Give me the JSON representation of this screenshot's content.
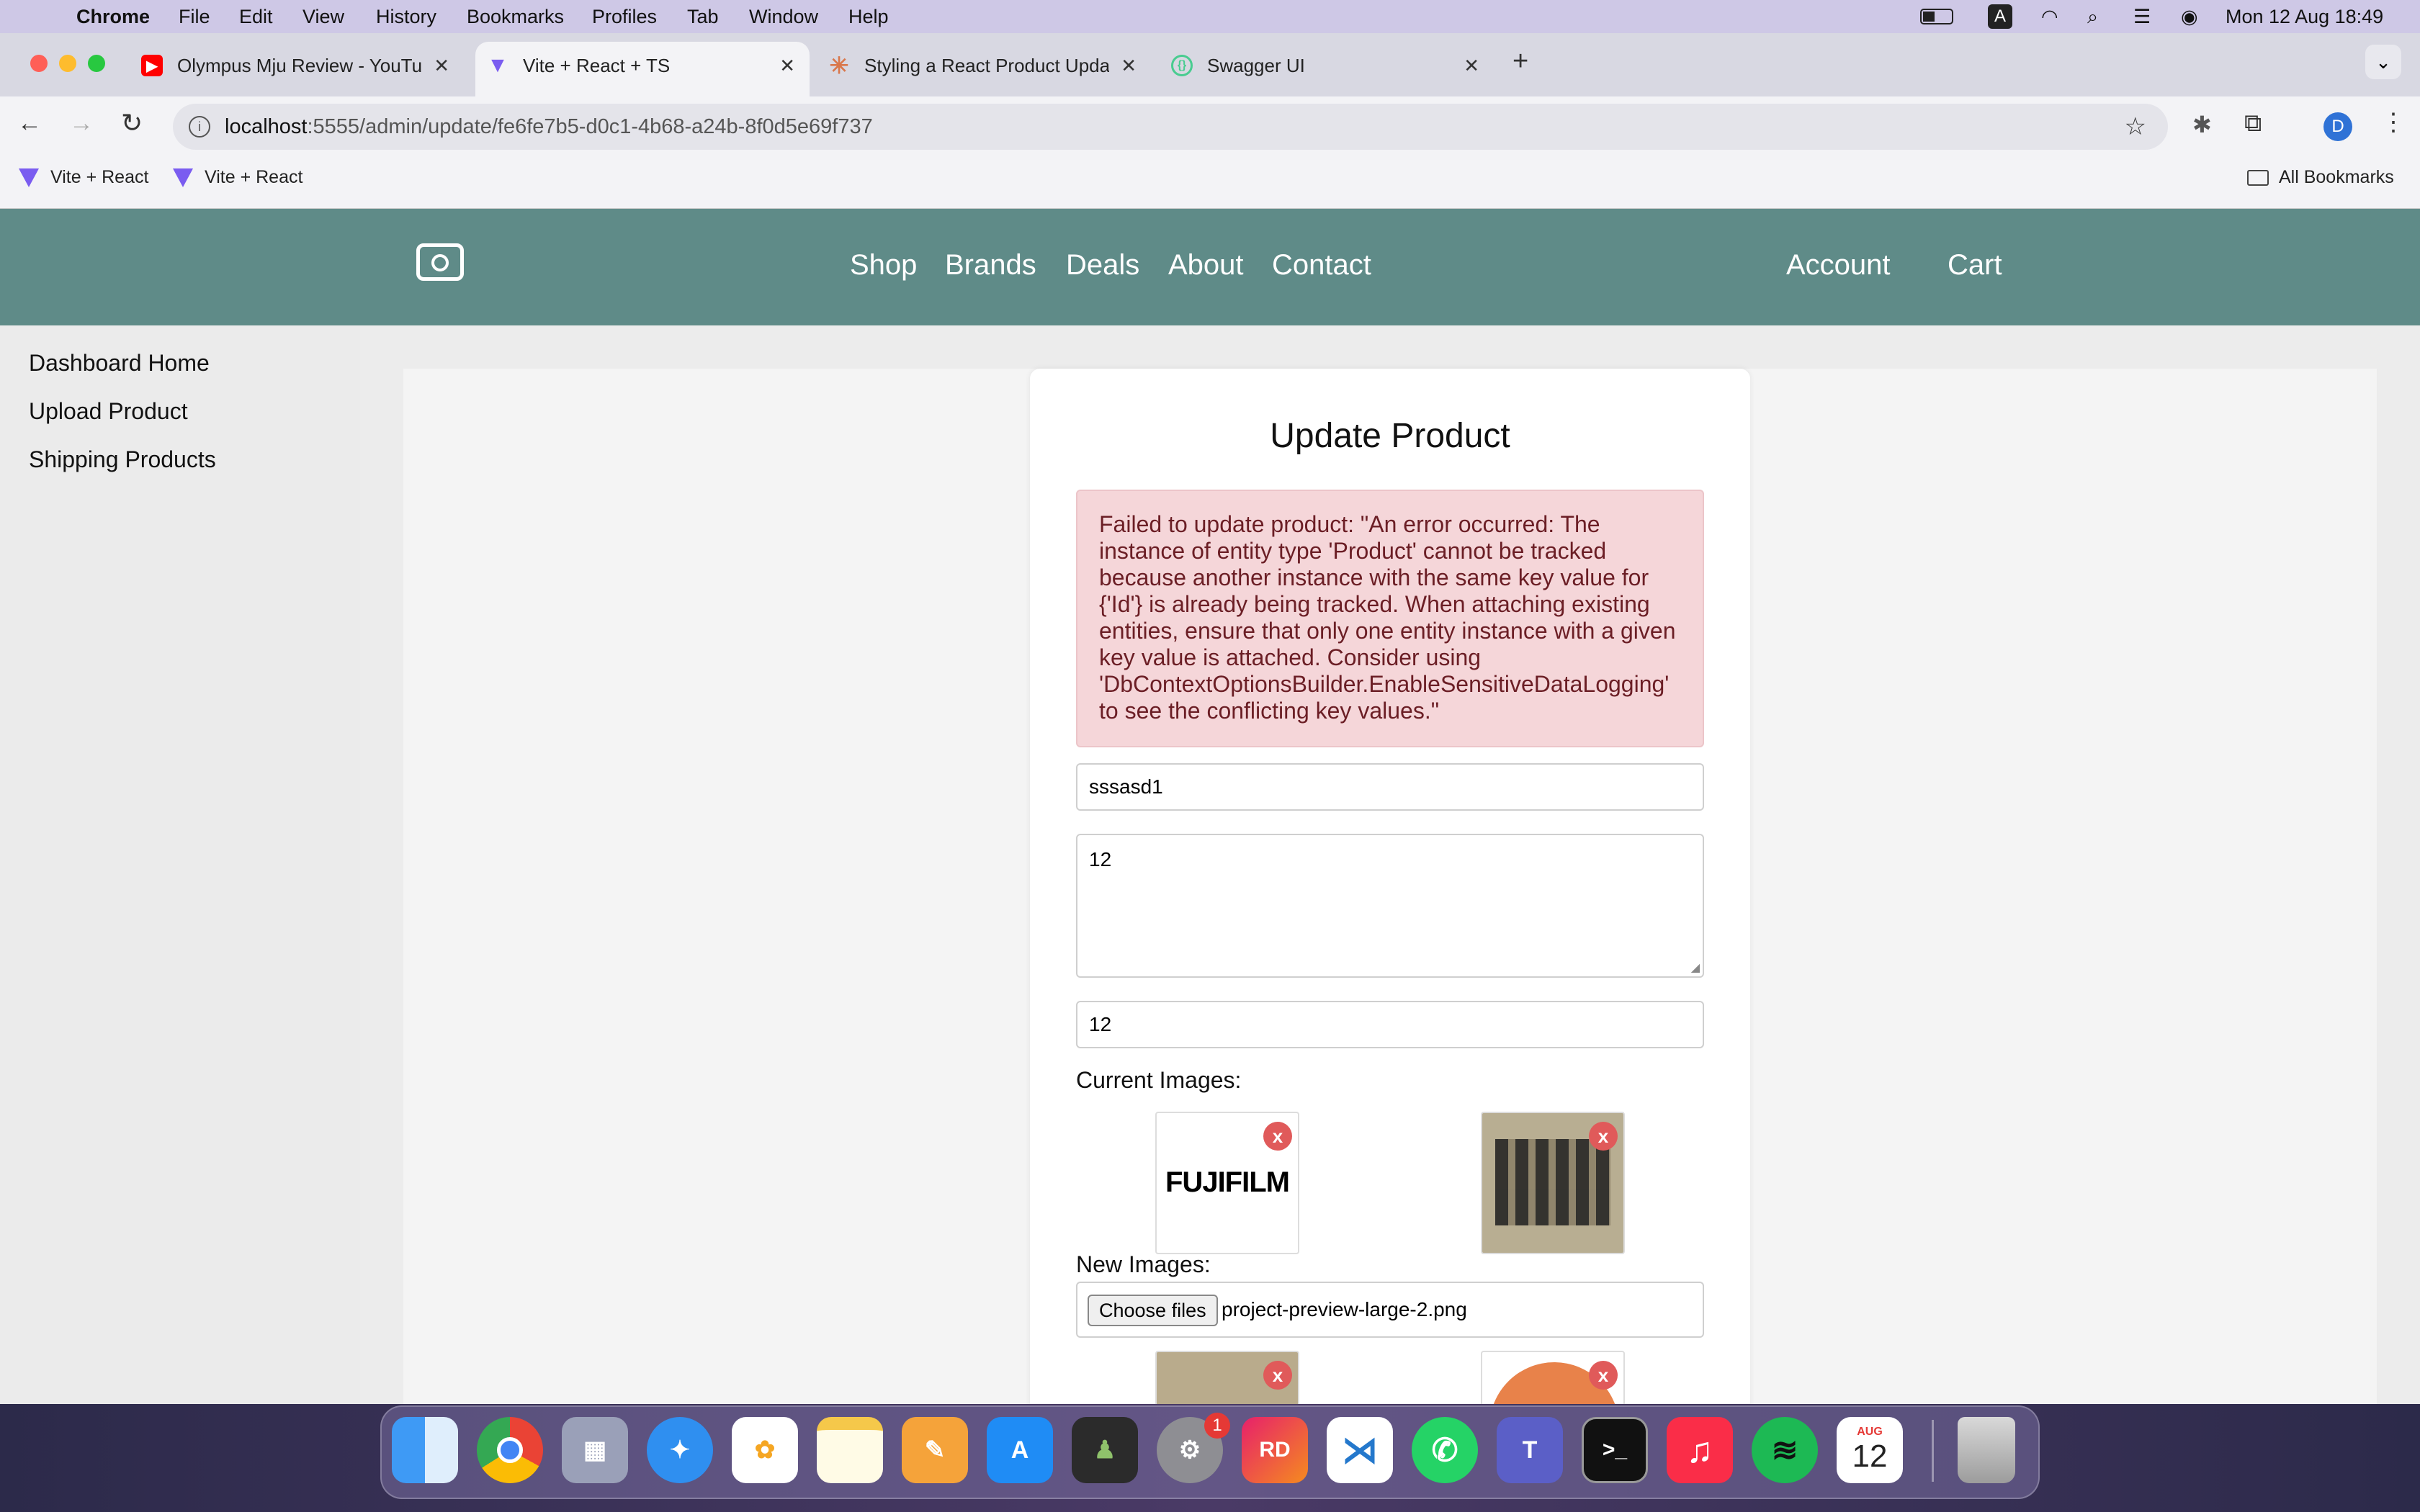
{
  "menubar": {
    "app": "Chrome",
    "items": [
      "File",
      "Edit",
      "View",
      "History",
      "Bookmarks",
      "Profiles",
      "Tab",
      "Window",
      "Help"
    ],
    "clock": "Mon 12 Aug  18:49",
    "input_source": "A"
  },
  "tabs": [
    {
      "title": "Olympus Mju Review - YouTube",
      "icon": "youtube-icon",
      "color": "#ff0000"
    },
    {
      "title": "Vite + React + TS",
      "icon": "vite-icon",
      "color": "#7a5cf0"
    },
    {
      "title": "Styling a React Product Update",
      "icon": "claude-icon",
      "color": "#d9774b"
    },
    {
      "title": "Swagger UI",
      "icon": "swagger-icon",
      "color": "#49cc90"
    }
  ],
  "omnibox": {
    "host": "localhost",
    "path": ":5555/admin/update/fe6fe7b5-d0c1-4b68-a24b-8f0d5e69f737"
  },
  "bookmarks": {
    "items": [
      "Vite + React",
      "Vite + React"
    ],
    "all": "All Bookmarks"
  },
  "profile_initial": "D",
  "nav": {
    "links": [
      "Shop",
      "Brands",
      "Deals",
      "About",
      "Contact"
    ],
    "account": "Account",
    "cart": "Cart"
  },
  "sidebar": {
    "items": [
      "Dashboard Home",
      "Upload Product",
      "Shipping Products"
    ]
  },
  "form": {
    "title": "Update Product",
    "error": "Failed to update product: \"An error occurred: The instance of entity type 'Product' cannot be tracked because another instance with the same key value for {'Id'} is already being tracked. When attaching existing entities, ensure that only one entity instance with a given key value is attached. Consider using 'DbContextOptionsBuilder.EnableSensitiveDataLogging' to see the conflicting key values.\"",
    "name_value": "sssasd1",
    "description_value": "12",
    "price_value": "12",
    "current_images_label": "Current Images:",
    "current_images": [
      "FUJIFILM",
      "camera-gear-photo"
    ],
    "delete_label": "x",
    "new_images_label": "New Images:",
    "file_button": "Choose files",
    "file_name": "project-preview-large-2.png"
  },
  "dock": {
    "badge": "1",
    "calendar_month": "AUG",
    "calendar_day": "12",
    "rider_label": "RD"
  }
}
